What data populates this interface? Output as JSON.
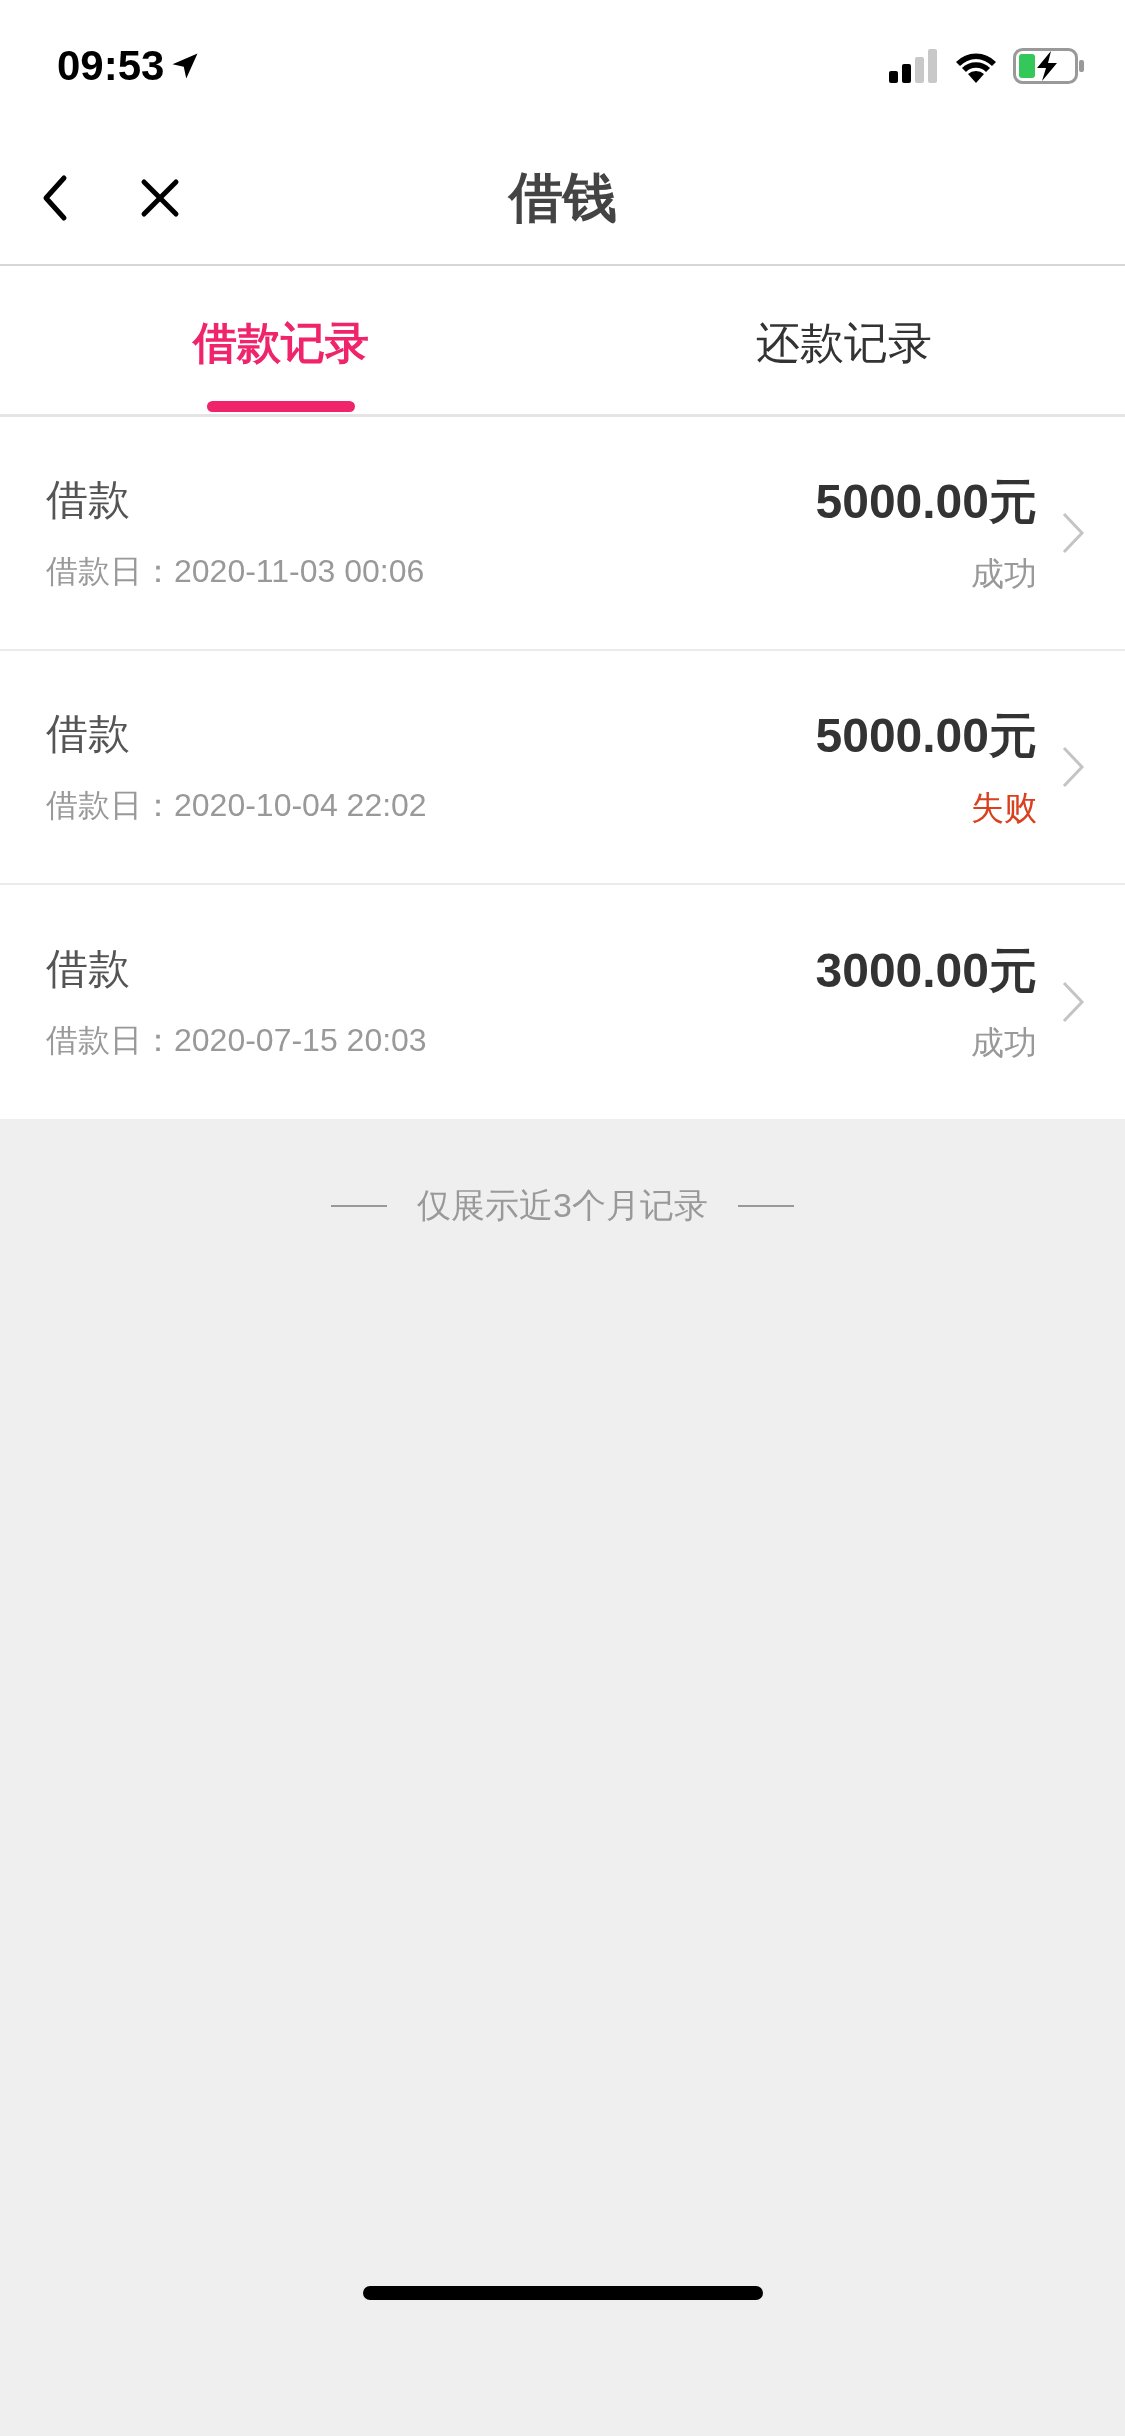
{
  "status_bar": {
    "time": "09:53"
  },
  "nav": {
    "title": "借钱"
  },
  "tabs": [
    {
      "label": "借款记录",
      "selected": true
    },
    {
      "label": "还款记录",
      "selected": false
    }
  ],
  "records": [
    {
      "title": "借款",
      "date": "借款日：2020-11-03 00:06",
      "amount": "5000.00元",
      "status": "成功",
      "color": "#999999"
    },
    {
      "title": "借款",
      "date": "借款日：2020-10-04 22:02",
      "amount": "5000.00元",
      "status": "失败",
      "color": "#d9401e"
    },
    {
      "title": "借款",
      "date": "借款日：2020-07-15 20:03",
      "amount": "3000.00元",
      "status": "成功",
      "color": "#999999"
    }
  ],
  "footer_note": "仅展示近3个月记录"
}
